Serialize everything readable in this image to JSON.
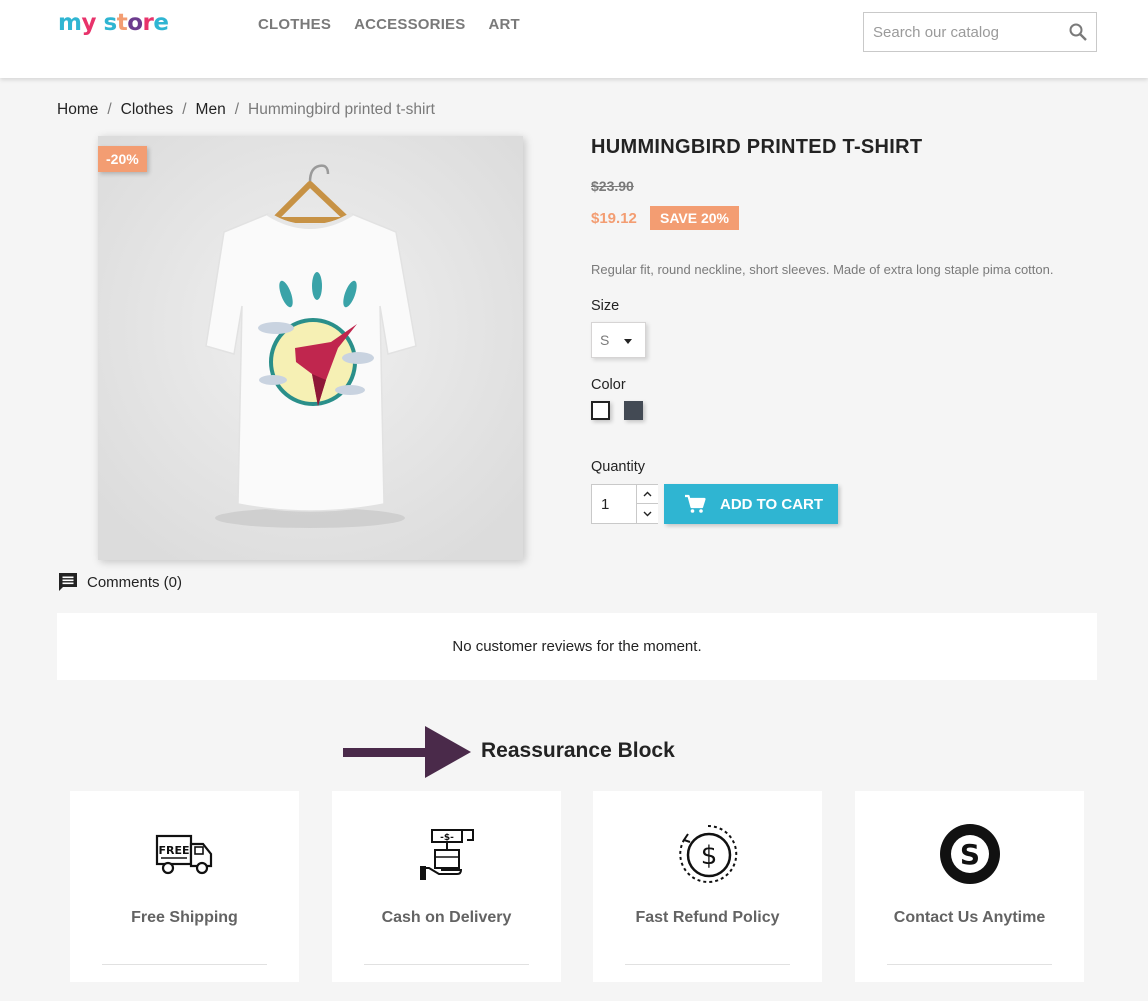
{
  "header": {
    "logo": "my store",
    "nav": [
      {
        "label": "CLOTHES"
      },
      {
        "label": "ACCESSORIES"
      },
      {
        "label": "ART"
      }
    ],
    "search_placeholder": "Search our catalog"
  },
  "breadcrumb": [
    {
      "label": "Home"
    },
    {
      "label": "Clothes"
    },
    {
      "label": "Men"
    },
    {
      "label": "Hummingbird printed t-shirt"
    }
  ],
  "product": {
    "discount_flag": "-20%",
    "title": "HUMMINGBIRD PRINTED T-SHIRT",
    "old_price": "$23.90",
    "new_price": "$19.12",
    "save_badge": "SAVE 20%",
    "description": "Regular fit, round neckline, short sleeves. Made of extra long staple pima cotton.",
    "size_label": "Size",
    "size_value": "S",
    "color_label": "Color",
    "colors": [
      {
        "name": "White",
        "hex": "#ffffff"
      },
      {
        "name": "Black",
        "hex": "#434a54"
      }
    ],
    "quantity_label": "Quantity",
    "quantity_value": "1",
    "add_to_cart": "ADD TO CART"
  },
  "comments": {
    "tab_label": "Comments (0)",
    "empty_message": "No customer reviews for the moment."
  },
  "reassurance": {
    "title": "Reassurance Block",
    "items": [
      {
        "label": "Free Shipping",
        "icon": "truck-icon"
      },
      {
        "label": "Cash on Delivery",
        "icon": "cash-on-delivery-icon"
      },
      {
        "label": "Fast Refund Policy",
        "icon": "refund-dollar-icon"
      },
      {
        "label": "Contact Us Anytime",
        "icon": "skype-icon"
      }
    ]
  },
  "colors": {
    "accent": "#2fb5d2",
    "discount": "#f39d72",
    "arrow": "#4a2a4a"
  }
}
